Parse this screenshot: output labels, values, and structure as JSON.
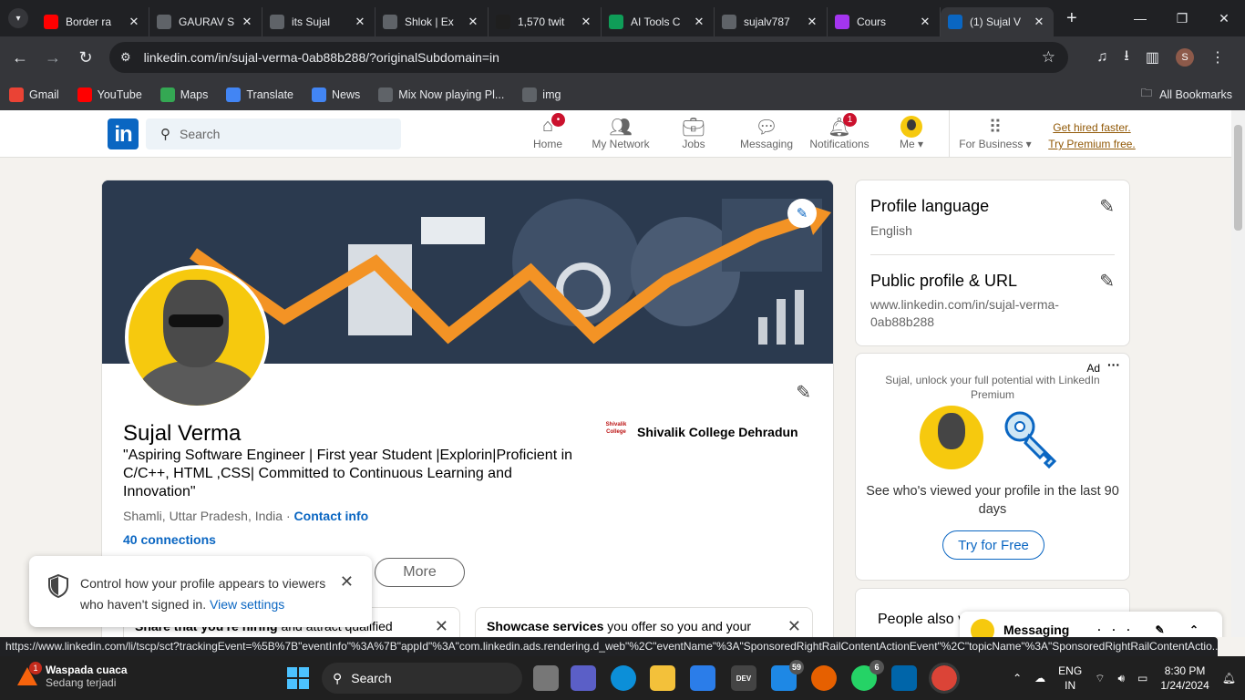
{
  "browser": {
    "tabs": [
      {
        "title": "Border ra",
        "favicon": "youtube-icon",
        "color": "#ff0000"
      },
      {
        "title": "GAURAV S",
        "favicon": "globe-icon",
        "color": "#5f6368"
      },
      {
        "title": "its Sujal",
        "favicon": "globe-icon",
        "color": "#5f6368"
      },
      {
        "title": "Shlok | Ex",
        "favicon": "globe-icon",
        "color": "#5f6368"
      },
      {
        "title": "1,570 twit",
        "favicon": "twitch-icon",
        "color": "#1f1f1f"
      },
      {
        "title": "AI Tools C",
        "favicon": "sheets-icon",
        "color": "#0f9d58"
      },
      {
        "title": "sujalv787",
        "favicon": "globe-icon",
        "color": "#5f6368"
      },
      {
        "title": "Cours",
        "favicon": "udemy-icon",
        "color": "#a435f0"
      },
      {
        "title": "(1) Sujal V",
        "favicon": "linkedin-icon",
        "color": "#0a66c2"
      }
    ],
    "url": "linkedin.com/in/sujal-verma-0ab88b288/?originalSubdomain=in",
    "profile_initial": "S",
    "bookmarks": [
      {
        "label": "Gmail",
        "color": "#ea4335"
      },
      {
        "label": "YouTube",
        "color": "#ff0000"
      },
      {
        "label": "Maps",
        "color": "#34a853"
      },
      {
        "label": "Translate",
        "color": "#4285f4"
      },
      {
        "label": "News",
        "color": "#4285f4"
      },
      {
        "label": "Mix Now playing Pl...",
        "color": "#5f6368"
      },
      {
        "label": "img",
        "color": "#5f6368"
      }
    ],
    "all_bookmarks": "All Bookmarks",
    "status_url": "https://www.linkedin.com/li/tscp/sct?trackingEvent=%5B%7B\"eventInfo\"%3A%7B\"appId\"%3A\"com.linkedin.ads.rendering.d_web\"%2C\"eventName\"%3A\"SponsoredRightRailContentActionEvent\"%2C\"topicName\"%3A\"SponsoredRightRailContentActio..."
  },
  "linkedin": {
    "logo": "in",
    "search_placeholder": "Search",
    "nav": [
      {
        "label": "Home",
        "icon": "home-icon",
        "badge": "•"
      },
      {
        "label": "My Network",
        "icon": "network-icon",
        "badge": ""
      },
      {
        "label": "Jobs",
        "icon": "briefcase-icon",
        "badge": ""
      },
      {
        "label": "Messaging",
        "icon": "chat-icon",
        "badge": ""
      },
      {
        "label": "Notifications",
        "icon": "bell-icon",
        "badge": "1"
      }
    ],
    "me_label": "Me ▾",
    "for_business": "For Business ▾",
    "premium_line1": "Get hired faster.",
    "premium_line2": "Try Premium free."
  },
  "profile": {
    "name": "Sujal Verma",
    "headline": "\"Aspiring Software Engineer | First year Student |Explorin|Proficient in C/C++, HTML ,CSS| Committed to Continuous Learning and Innovation\"",
    "location": "Shamli, Uttar Pradesh, India",
    "separator": "·",
    "contact_info": "Contact info",
    "connections": "40 connections",
    "education": "Shivalik College Dehradun",
    "edu_logo_text": "Shivalik College",
    "more_button": "More",
    "open_card_1_bold": "Share that you're hiring",
    "open_card_1_rest": " and attract qualified",
    "open_card_2_bold": "Showcase services",
    "open_card_2_rest": " you offer so you and your"
  },
  "sidebar": {
    "profile_language_title": "Profile language",
    "profile_language_value": "English",
    "public_profile_title": "Public profile & URL",
    "public_profile_url": "www.linkedin.com/in/sujal-verma-0ab88b288",
    "ad_label": "Ad",
    "ad_text": "Sujal, unlock your full potential with LinkedIn Premium",
    "ad_main": "See who's viewed your profile in the last 90 days",
    "ad_button": "Try for Free",
    "people_also": "People also v"
  },
  "toast": {
    "text": "Control how your profile appears to viewers who haven't signed in.",
    "link": "View settings"
  },
  "messaging": {
    "label": "Messaging",
    "icons": "··· ✎ ⌃"
  },
  "taskbar": {
    "weather_title": "Waspada cuaca",
    "weather_sub": "Sedang terjadi",
    "weather_badge": "1",
    "search_label": "Search",
    "badge_store": "59",
    "badge_whatsapp": "6",
    "lang_1": "ENG",
    "lang_2": "IN",
    "time": "8:30 PM",
    "date": "1/24/2024"
  }
}
